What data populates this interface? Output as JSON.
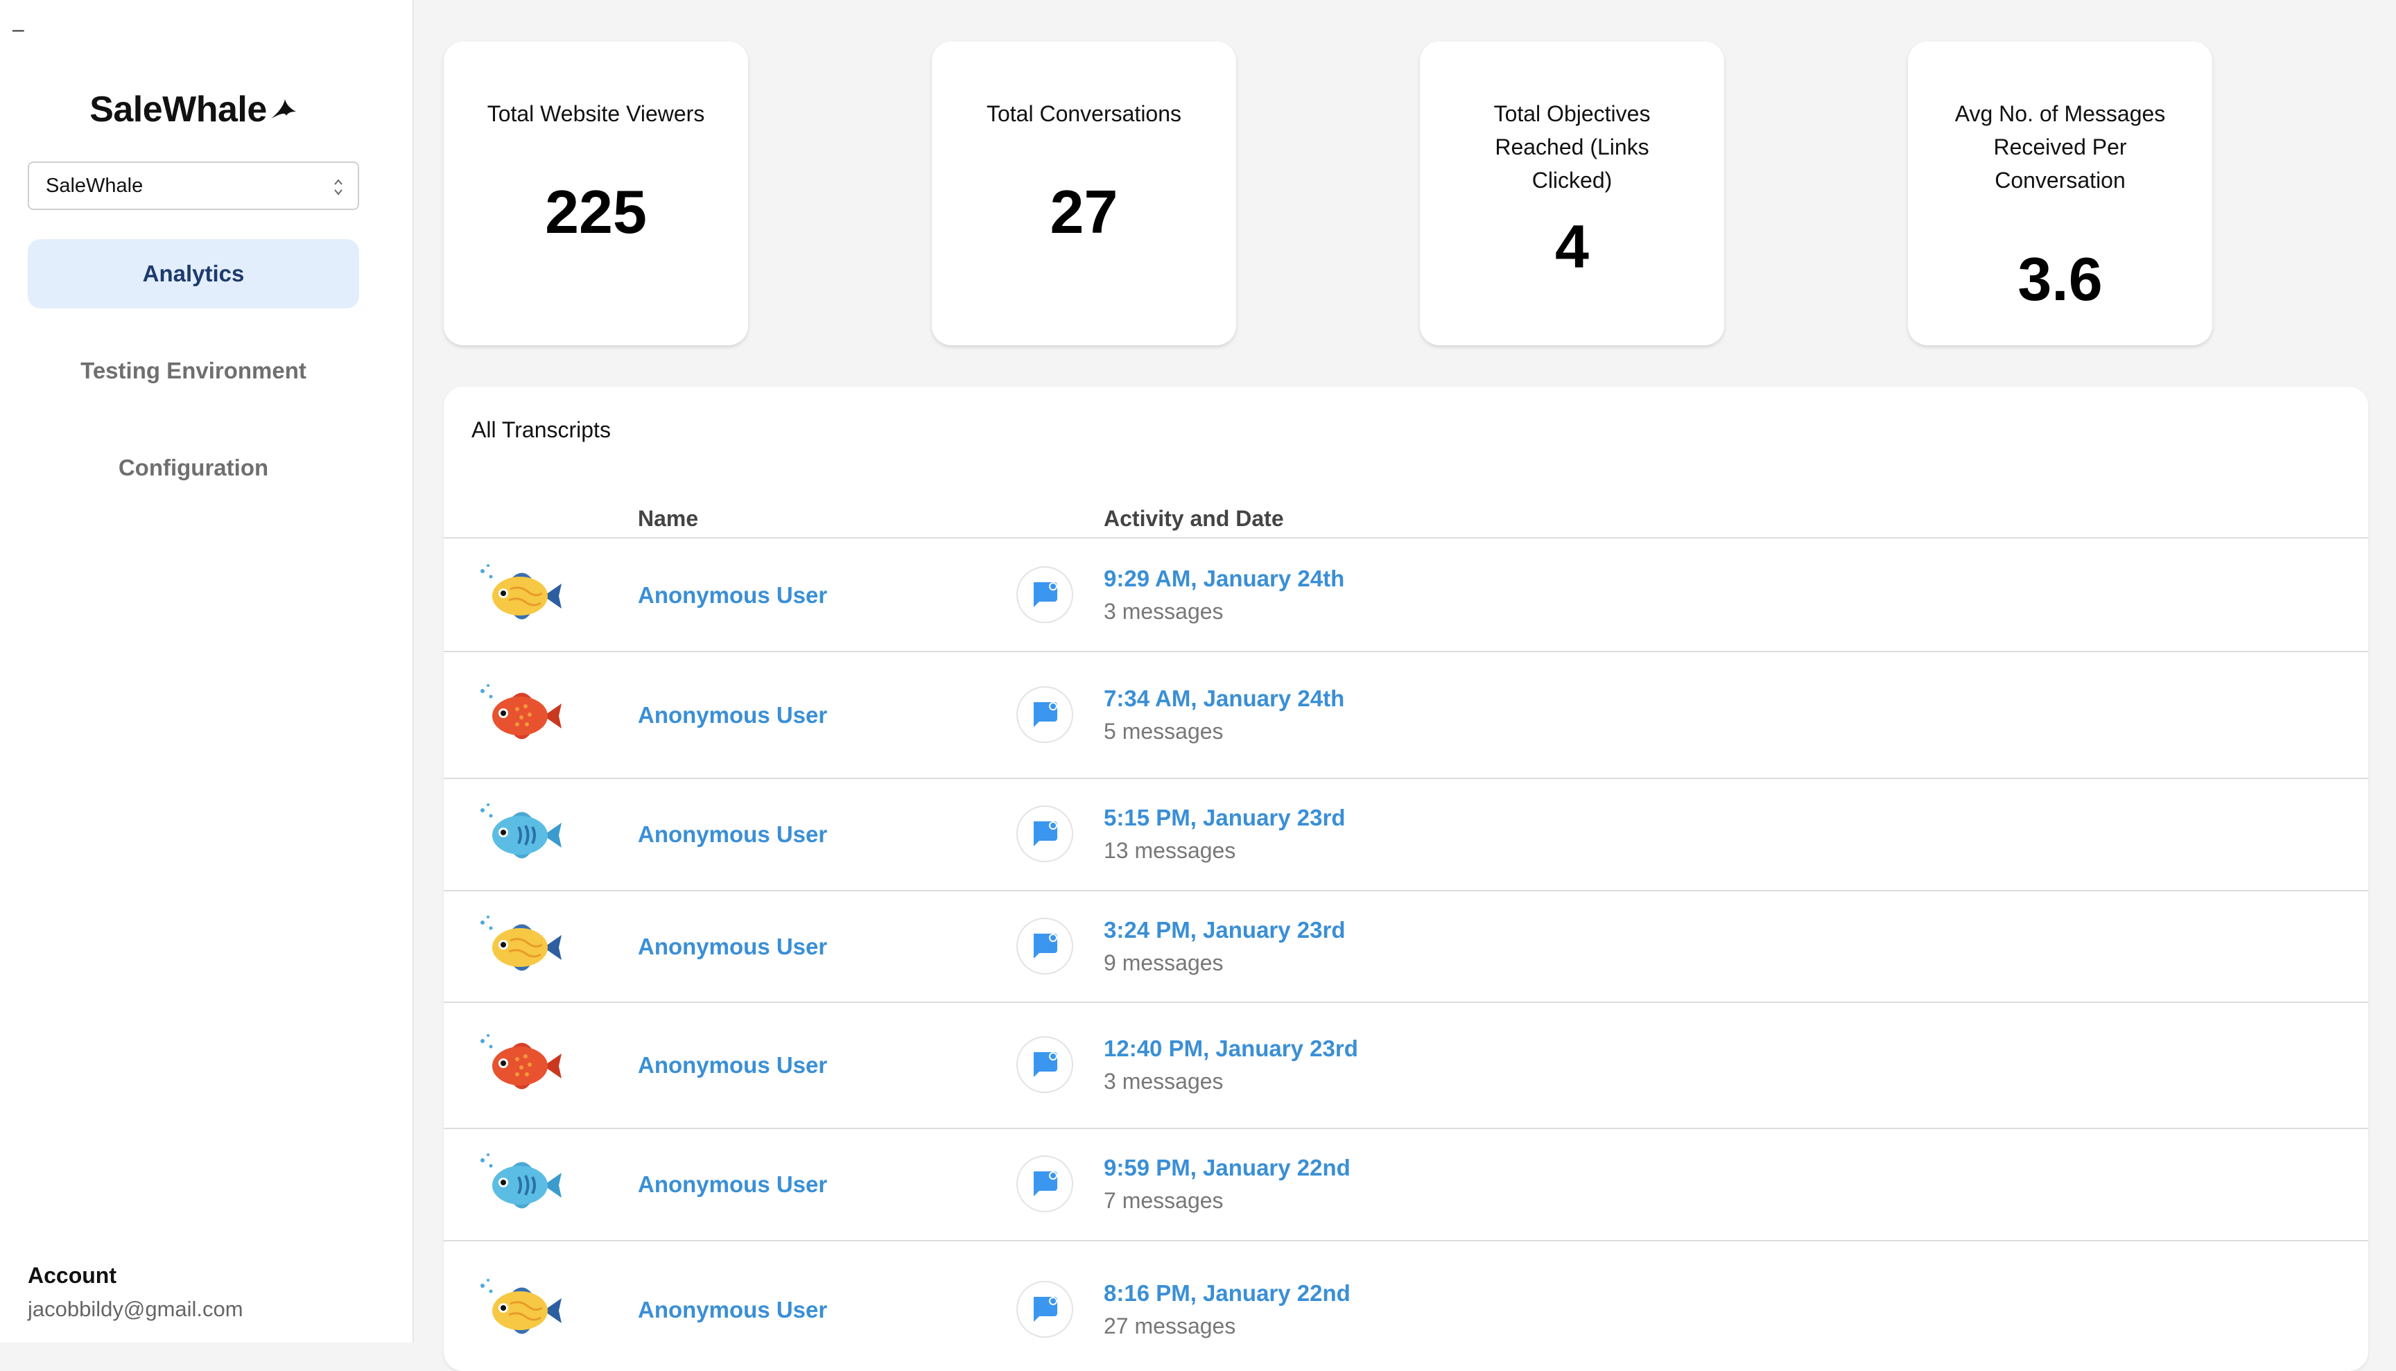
{
  "sidebar": {
    "menu_glyph": "–",
    "logo_text": "SaleWhale",
    "selector_value": "SaleWhale",
    "nav": [
      {
        "label": "Analytics",
        "active": true
      },
      {
        "label": "Testing Environment",
        "active": false
      },
      {
        "label": "Configuration",
        "active": false
      }
    ],
    "account_title": "Account",
    "account_email": "jacobbildy@gmail.com"
  },
  "stats": [
    {
      "label": "Total Website Viewers",
      "value": "225"
    },
    {
      "label": "Total Conversations",
      "value": "27"
    },
    {
      "label": "Total Objectives Reached (Links Clicked)",
      "value": "4"
    },
    {
      "label": "Avg No. of Messages Received Per Conversation",
      "value": "3.6"
    }
  ],
  "transcripts": {
    "title": "All Transcripts",
    "columns": {
      "name": "Name",
      "activity": "Activity and Date"
    },
    "rows": [
      {
        "avatar": "yellow-fish-icon",
        "name": "Anonymous User",
        "date": "9:29 AM, January 24th",
        "messages": "3 messages"
      },
      {
        "avatar": "red-fish-icon",
        "name": "Anonymous User",
        "date": "7:34 AM, January 24th",
        "messages": "5 messages"
      },
      {
        "avatar": "blue-fish-icon",
        "name": "Anonymous User",
        "date": "5:15 PM, January 23rd",
        "messages": "13 messages"
      },
      {
        "avatar": "yellow-fish-icon",
        "name": "Anonymous User",
        "date": "3:24 PM, January 23rd",
        "messages": "9 messages"
      },
      {
        "avatar": "red-fish-icon",
        "name": "Anonymous User",
        "date": "12:40 PM, January 23rd",
        "messages": "3 messages"
      },
      {
        "avatar": "blue-fish-icon",
        "name": "Anonymous User",
        "date": "9:59 PM, January 22nd",
        "messages": "7 messages"
      },
      {
        "avatar": "yellow-fish-icon",
        "name": "Anonymous User",
        "date": "8:16 PM, January 22nd",
        "messages": "27 messages"
      }
    ]
  },
  "colors": {
    "accent_link": "#3a8fd6",
    "chat_icon": "#3a96ee",
    "active_nav_bg": "#e3eefc",
    "active_nav_text": "#1d3b6c",
    "page_bg": "#f4f4f4"
  }
}
